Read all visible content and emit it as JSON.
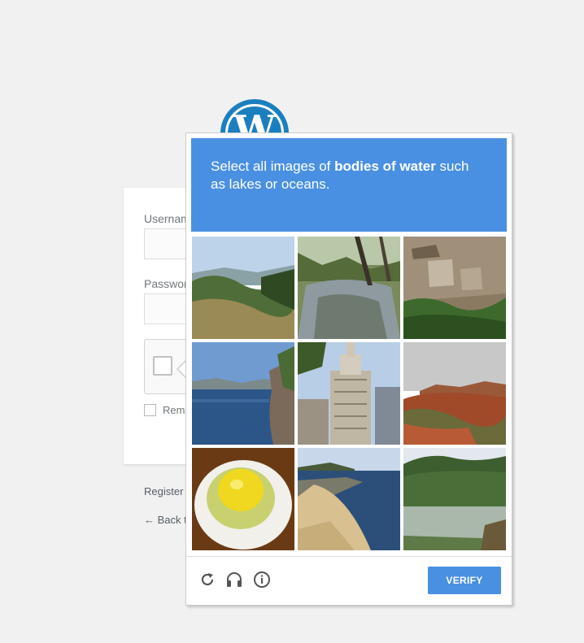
{
  "login": {
    "username_label": "Usernam",
    "password_label": "Passwor",
    "remember_label": "Reme",
    "register_link": "Register",
    "back_link": "← Back t"
  },
  "challenge": {
    "prompt_prefix": "Select all images of ",
    "prompt_bold": "bodies of water",
    "prompt_suffix": " such as lakes or oceans.",
    "tiles": [
      {
        "name": "tile-hills-valley",
        "selected": false
      },
      {
        "name": "tile-creek-stream",
        "selected": false
      },
      {
        "name": "tile-cliff-dwelling",
        "selected": false
      },
      {
        "name": "tile-lake-shore",
        "selected": false
      },
      {
        "name": "tile-skyscraper",
        "selected": false
      },
      {
        "name": "tile-red-rock-desert",
        "selected": false
      },
      {
        "name": "tile-egg-cup",
        "selected": false
      },
      {
        "name": "tile-ocean-pier",
        "selected": false
      },
      {
        "name": "tile-mountain-lake",
        "selected": false
      }
    ],
    "icons": [
      "reload-icon",
      "audio-icon",
      "info-icon"
    ],
    "verify_label": "VERIFY",
    "accent_color": "#4a90e2"
  },
  "brand_icon": "wordpress-logo-icon"
}
